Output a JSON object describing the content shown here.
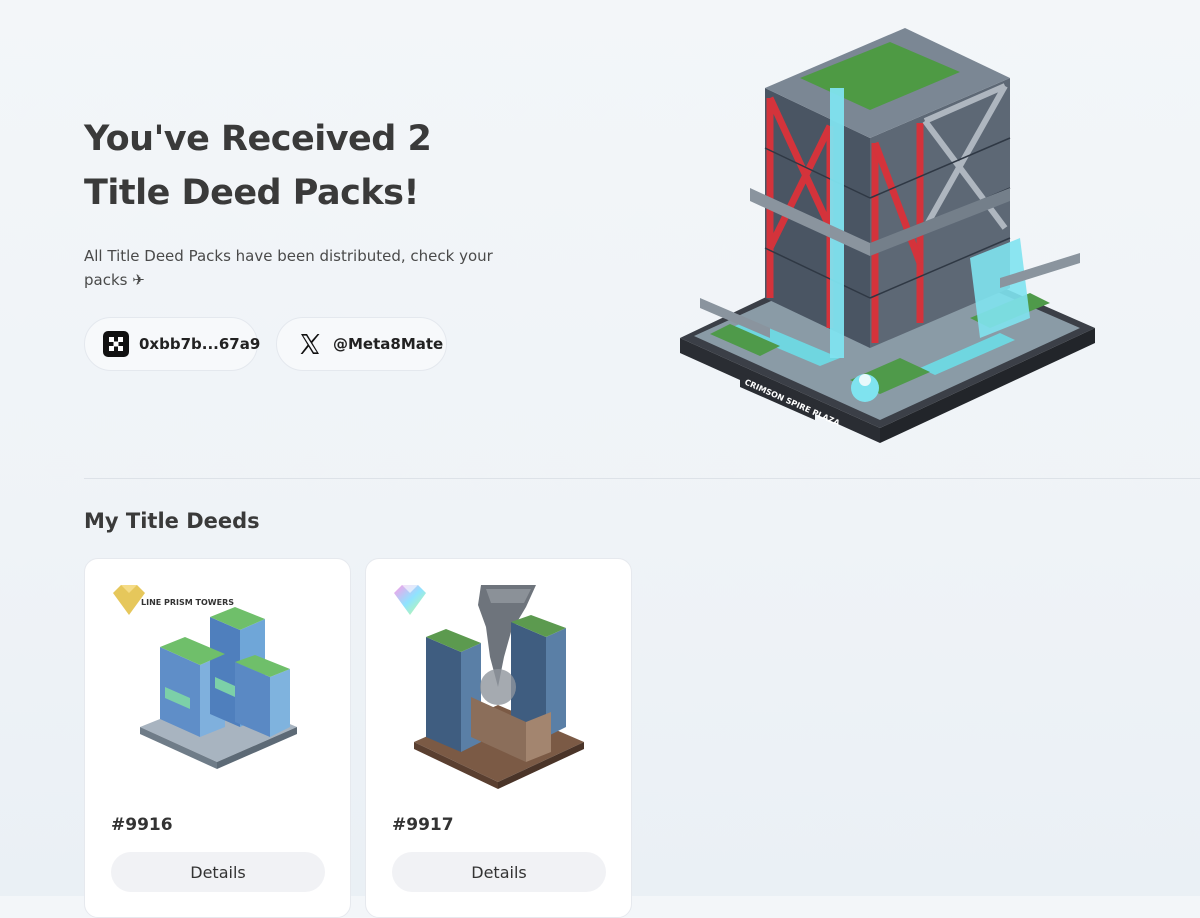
{
  "hero": {
    "title": "You've Received 2 Title Deed Packs!",
    "subtitle": "All Title Deed Packs have been distributed, check your packs ✈",
    "image_label": "CRIMSON SPIRE PLAZA"
  },
  "profile": {
    "wallet": "0xbb7b...67a9",
    "wallet_icon": "wallet-logo-icon",
    "x_handle": "@Meta8Mate",
    "x_icon": "x-logo-icon"
  },
  "deeds": {
    "section_title": "My Title Deeds",
    "items": [
      {
        "number": "#9916",
        "button_label": "Details",
        "badge_icon": "gold-diamond-icon",
        "image_caption": "LINE PRISM TOWERS",
        "badge_color": "#e6c75b"
      },
      {
        "number": "#9917",
        "button_label": "Details",
        "badge_icon": "rainbow-diamond-icon",
        "image_caption": "",
        "badge_color": "#8fe3ff"
      }
    ]
  },
  "colors": {
    "accent_red": "#d4333b",
    "water": "#7fe3ef",
    "card_bg": "#ffffff",
    "button_bg": "#f1f2f5"
  }
}
